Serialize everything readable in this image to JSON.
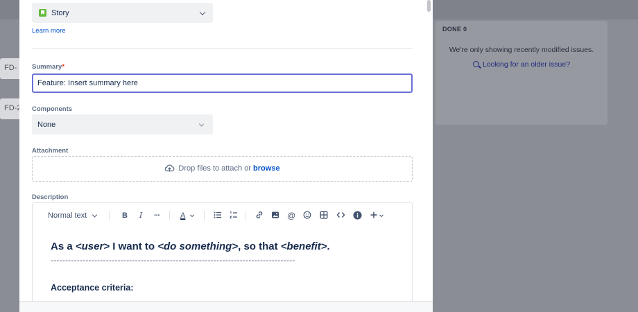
{
  "background": {
    "cards": [
      "FD-",
      "FD-2"
    ],
    "done_column": {
      "title": "DONE 0",
      "message": "We're only showing recently modified issues.",
      "link": "Looking for an older issue?"
    }
  },
  "issue_type": {
    "value": "Story",
    "icon": "story-icon",
    "color": "#63ba3c"
  },
  "learn_more": "Learn more",
  "summary": {
    "label": "Summary",
    "required_marker": "*",
    "value": "Feature: Insert summary here"
  },
  "components": {
    "label": "Components",
    "value": "None"
  },
  "attachment": {
    "label": "Attachment",
    "drop_text": "Drop files to attach or",
    "browse": "browse"
  },
  "description": {
    "label": "Description",
    "toolbar": {
      "text_style": "Normal text",
      "bold": "B",
      "italic": "I",
      "more": "···",
      "color": "A"
    },
    "content": {
      "story_parts": [
        "As a ",
        "<user>",
        " I want to ",
        "<do something>",
        ", so that ",
        "<benefit>",
        "."
      ],
      "dashes": "------------------------------------------------------------------------------------",
      "acceptance": "Acceptance criteria:"
    }
  },
  "colors": {
    "accent": "#0052cc",
    "focus_border": "#6b6fd6",
    "required": "#de350b"
  }
}
